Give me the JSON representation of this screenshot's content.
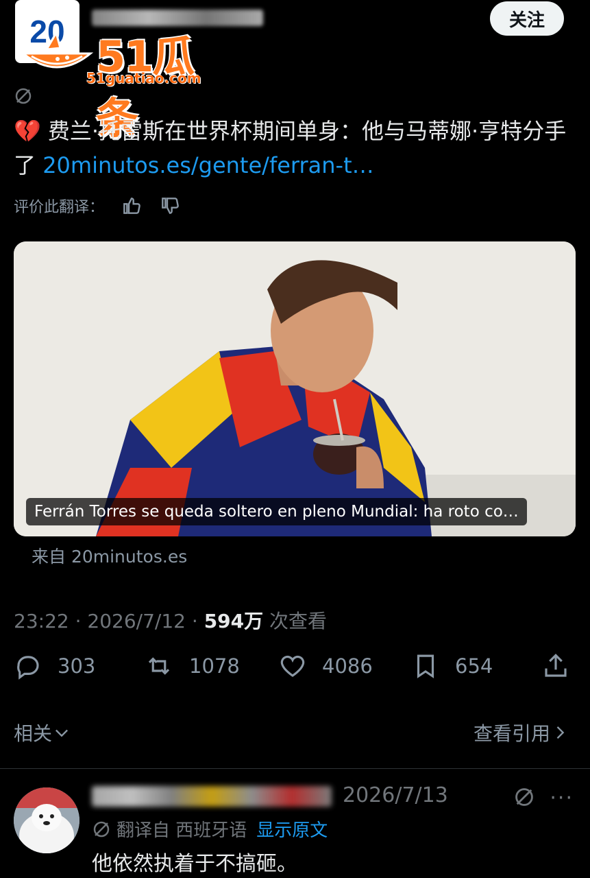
{
  "header": {
    "avatar_text": "20",
    "follow_label": "关注"
  },
  "watermark": {
    "title": "51瓜条",
    "url": "51guatiao.com"
  },
  "post": {
    "emoji": "💔",
    "text": "费兰·托雷斯在世界杯期间单身：他与马蒂娜·亨特分手了",
    "link": "20minutos.es/gente/ferran-t…",
    "rate_label": "评价此翻译：",
    "media_caption": "Ferrán Torres se queda soltero en pleno Mundial: ha roto co…",
    "source": "来自 20minutos.es",
    "time": "23:22",
    "date": "2026/7/12",
    "views_count": "594万",
    "views_label": "次查看"
  },
  "actions": {
    "replies": "303",
    "reposts": "1078",
    "likes": "4086",
    "bookmarks": "654"
  },
  "nav": {
    "related": "相关",
    "view_quotes": "查看引用"
  },
  "reply": {
    "date": "2026/7/13",
    "more": "···",
    "translated_from": "翻译自 西班牙语",
    "show_original": "显示原文",
    "text": "他依然执着于不搞砸。"
  },
  "colors": {
    "background": "#000000",
    "text": "#e7e9ea",
    "muted": "#71767b",
    "link": "#1d9bf0",
    "watermark": "#ff7a1f"
  }
}
